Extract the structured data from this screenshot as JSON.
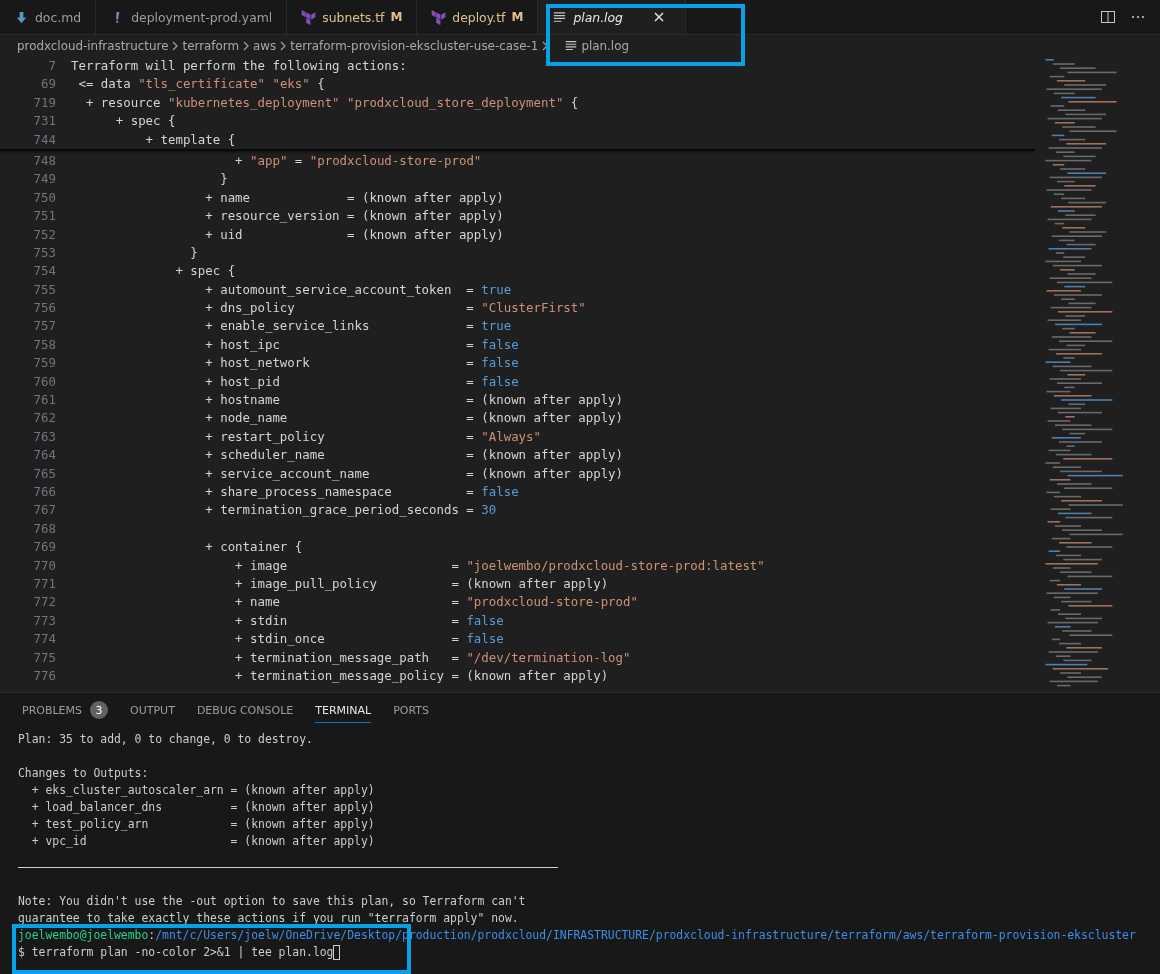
{
  "tabs": [
    {
      "label": "doc.md",
      "kind": "markdown",
      "selected": false,
      "preview": false
    },
    {
      "label": "deployment-prod.yaml",
      "kind": "yaml",
      "selected": false,
      "preview": false
    },
    {
      "label": "subnets.tf",
      "kind": "terraform",
      "status": "M",
      "selected": false,
      "preview": false
    },
    {
      "label": "deploy.tf",
      "kind": "terraform",
      "status": "M",
      "selected": false,
      "preview": false
    },
    {
      "label": "plan.log",
      "kind": "log",
      "selected": true,
      "preview": true
    }
  ],
  "breadcrumbs": [
    {
      "label": "prodxcloud-infrastructure",
      "kind": "folder"
    },
    {
      "label": "terraform",
      "kind": "folder"
    },
    {
      "label": "aws",
      "kind": "folder"
    },
    {
      "label": "terraform-provision-ekscluster-use-case-1",
      "kind": "folder"
    },
    {
      "label": "plan.log",
      "kind": "file"
    }
  ],
  "editor": {
    "sticky_lines": [
      {
        "n": "7",
        "parts": [
          {
            "t": "Terraform will perform the following actions:",
            "kind": "plain"
          }
        ]
      },
      {
        "n": "69",
        "parts": [
          {
            "t": " <= data ",
            "kind": "plain"
          },
          {
            "t": "\"tls_certificate\"",
            "kind": "string"
          },
          {
            "t": " \"eks\"",
            "kind": "string"
          },
          {
            "t": " {",
            "kind": "plain"
          }
        ]
      },
      {
        "n": "719",
        "parts": [
          {
            "t": "  + resource ",
            "kind": "plain"
          },
          {
            "t": "\"kubernetes_deployment\"",
            "kind": "string"
          },
          {
            "t": " \"prodxcloud_store_deployment\"",
            "kind": "string"
          },
          {
            "t": " {",
            "kind": "plain"
          }
        ]
      },
      {
        "n": "731",
        "parts": [
          {
            "t": "      + spec {",
            "kind": "plain"
          }
        ]
      },
      {
        "n": "744",
        "parts": [
          {
            "t": "          + template {",
            "kind": "plain"
          }
        ]
      }
    ],
    "lines": [
      {
        "n": "748",
        "parts": [
          {
            "t": "                      + ",
            "kind": "plain"
          },
          {
            "t": "\"app\"",
            "kind": "string"
          },
          {
            "t": " = ",
            "kind": "plain"
          },
          {
            "t": "\"prodxcloud-store-prod\"",
            "kind": "string"
          }
        ]
      },
      {
        "n": "749",
        "parts": [
          {
            "t": "                    }",
            "kind": "plain"
          }
        ]
      },
      {
        "n": "750",
        "parts": [
          {
            "t": "                  + name             = (known after apply)",
            "kind": "plain"
          }
        ]
      },
      {
        "n": "751",
        "parts": [
          {
            "t": "                  + resource_version = (known after apply)",
            "kind": "plain"
          }
        ]
      },
      {
        "n": "752",
        "parts": [
          {
            "t": "                  + uid              = (known after apply)",
            "kind": "plain"
          }
        ]
      },
      {
        "n": "753",
        "parts": [
          {
            "t": "                }",
            "kind": "plain"
          }
        ]
      },
      {
        "n": "754",
        "parts": [
          {
            "t": "              + spec {",
            "kind": "plain"
          }
        ]
      },
      {
        "n": "755",
        "parts": [
          {
            "t": "                  + automount_service_account_token  = ",
            "kind": "plain"
          },
          {
            "t": "true",
            "kind": "value"
          }
        ]
      },
      {
        "n": "756",
        "parts": [
          {
            "t": "                  + dns_policy                       = ",
            "kind": "plain"
          },
          {
            "t": "\"ClusterFirst\"",
            "kind": "string"
          }
        ]
      },
      {
        "n": "757",
        "parts": [
          {
            "t": "                  + enable_service_links             = ",
            "kind": "plain"
          },
          {
            "t": "true",
            "kind": "value"
          }
        ]
      },
      {
        "n": "758",
        "parts": [
          {
            "t": "                  + host_ipc                         = ",
            "kind": "plain"
          },
          {
            "t": "false",
            "kind": "value"
          }
        ]
      },
      {
        "n": "759",
        "parts": [
          {
            "t": "                  + host_network                     = ",
            "kind": "plain"
          },
          {
            "t": "false",
            "kind": "value"
          }
        ]
      },
      {
        "n": "760",
        "parts": [
          {
            "t": "                  + host_pid                         = ",
            "kind": "plain"
          },
          {
            "t": "false",
            "kind": "value"
          }
        ]
      },
      {
        "n": "761",
        "parts": [
          {
            "t": "                  + hostname                         = (known after apply)",
            "kind": "plain"
          }
        ]
      },
      {
        "n": "762",
        "parts": [
          {
            "t": "                  + node_name                        = (known after apply)",
            "kind": "plain"
          }
        ]
      },
      {
        "n": "763",
        "parts": [
          {
            "t": "                  + restart_policy                   = ",
            "kind": "plain"
          },
          {
            "t": "\"Always\"",
            "kind": "string"
          }
        ]
      },
      {
        "n": "764",
        "parts": [
          {
            "t": "                  + scheduler_name                   = (known after apply)",
            "kind": "plain"
          }
        ]
      },
      {
        "n": "765",
        "parts": [
          {
            "t": "                  + service_account_name             = (known after apply)",
            "kind": "plain"
          }
        ]
      },
      {
        "n": "766",
        "parts": [
          {
            "t": "                  + share_process_namespace          = ",
            "kind": "plain"
          },
          {
            "t": "false",
            "kind": "value"
          }
        ]
      },
      {
        "n": "767",
        "parts": [
          {
            "t": "                  + termination_grace_period_seconds = ",
            "kind": "plain"
          },
          {
            "t": "30",
            "kind": "value"
          }
        ]
      },
      {
        "n": "768"
      },
      {
        "n": "769",
        "parts": [
          {
            "t": "                  + container {",
            "kind": "plain"
          }
        ]
      },
      {
        "n": "770",
        "parts": [
          {
            "t": "                      + image                      = ",
            "kind": "plain"
          },
          {
            "t": "\"joelwembo/prodxcloud-store-prod:latest\"",
            "kind": "string"
          }
        ]
      },
      {
        "n": "771",
        "parts": [
          {
            "t": "                      + image_pull_policy          = (known after apply)",
            "kind": "plain"
          }
        ]
      },
      {
        "n": "772",
        "parts": [
          {
            "t": "                      + name                       = ",
            "kind": "plain"
          },
          {
            "t": "\"prodxcloud-store-prod\"",
            "kind": "string"
          }
        ]
      },
      {
        "n": "773",
        "parts": [
          {
            "t": "                      + stdin                      = ",
            "kind": "plain"
          },
          {
            "t": "false",
            "kind": "value"
          }
        ]
      },
      {
        "n": "774",
        "parts": [
          {
            "t": "                      + stdin_once                 = ",
            "kind": "plain"
          },
          {
            "t": "false",
            "kind": "value"
          }
        ]
      },
      {
        "n": "775",
        "parts": [
          {
            "t": "                      + termination_message_path   = ",
            "kind": "plain"
          },
          {
            "t": "\"/dev/termination-log\"",
            "kind": "string"
          }
        ]
      },
      {
        "n": "776",
        "parts": [
          {
            "t": "                      + termination_message_policy = (known after apply)",
            "kind": "plain"
          }
        ]
      }
    ]
  },
  "panel": {
    "tabs": [
      {
        "label": "PROBLEMS",
        "count": "3",
        "selected": false
      },
      {
        "label": "OUTPUT",
        "selected": false
      },
      {
        "label": "DEBUG CONSOLE",
        "selected": false
      },
      {
        "label": "TERMINAL",
        "selected": true
      },
      {
        "label": "PORTS",
        "selected": false
      }
    ],
    "terminal": [
      {
        "kind": "text",
        "lines": [
          "Plan: 35 to add, 0 to change, 0 to destroy."
        ]
      },
      {
        "kind": "text",
        "lines": [
          "Changes to Outputs:",
          "  + eks_cluster_autoscaler_arn = (known after apply)",
          "  + load_balancer_dns          = (known after apply)",
          "  + test_policy_arn            = (known after apply)",
          "  + vpc_id                     = (known after apply)"
        ]
      },
      {
        "kind": "rule"
      },
      {
        "kind": "text",
        "lines": [
          "Note: You didn't use the -out option to save this plan, so Terraform can't",
          "guarantee to take exactly these actions if you run \"terraform apply\" now."
        ]
      },
      {
        "kind": "prompt",
        "user": "joelwembo@joelwembo",
        "separator": ":",
        "path": "/mnt/c/Users/joelw/OneDrive/Desktop/production/prodxcloud/INFRASTRUCTURE/prodxcloud-infrastructure/terraform/aws/terraform-provision-ekscluster",
        "command": "$ terraform plan -no-color 2>&1 | tee plan.log"
      }
    ]
  }
}
